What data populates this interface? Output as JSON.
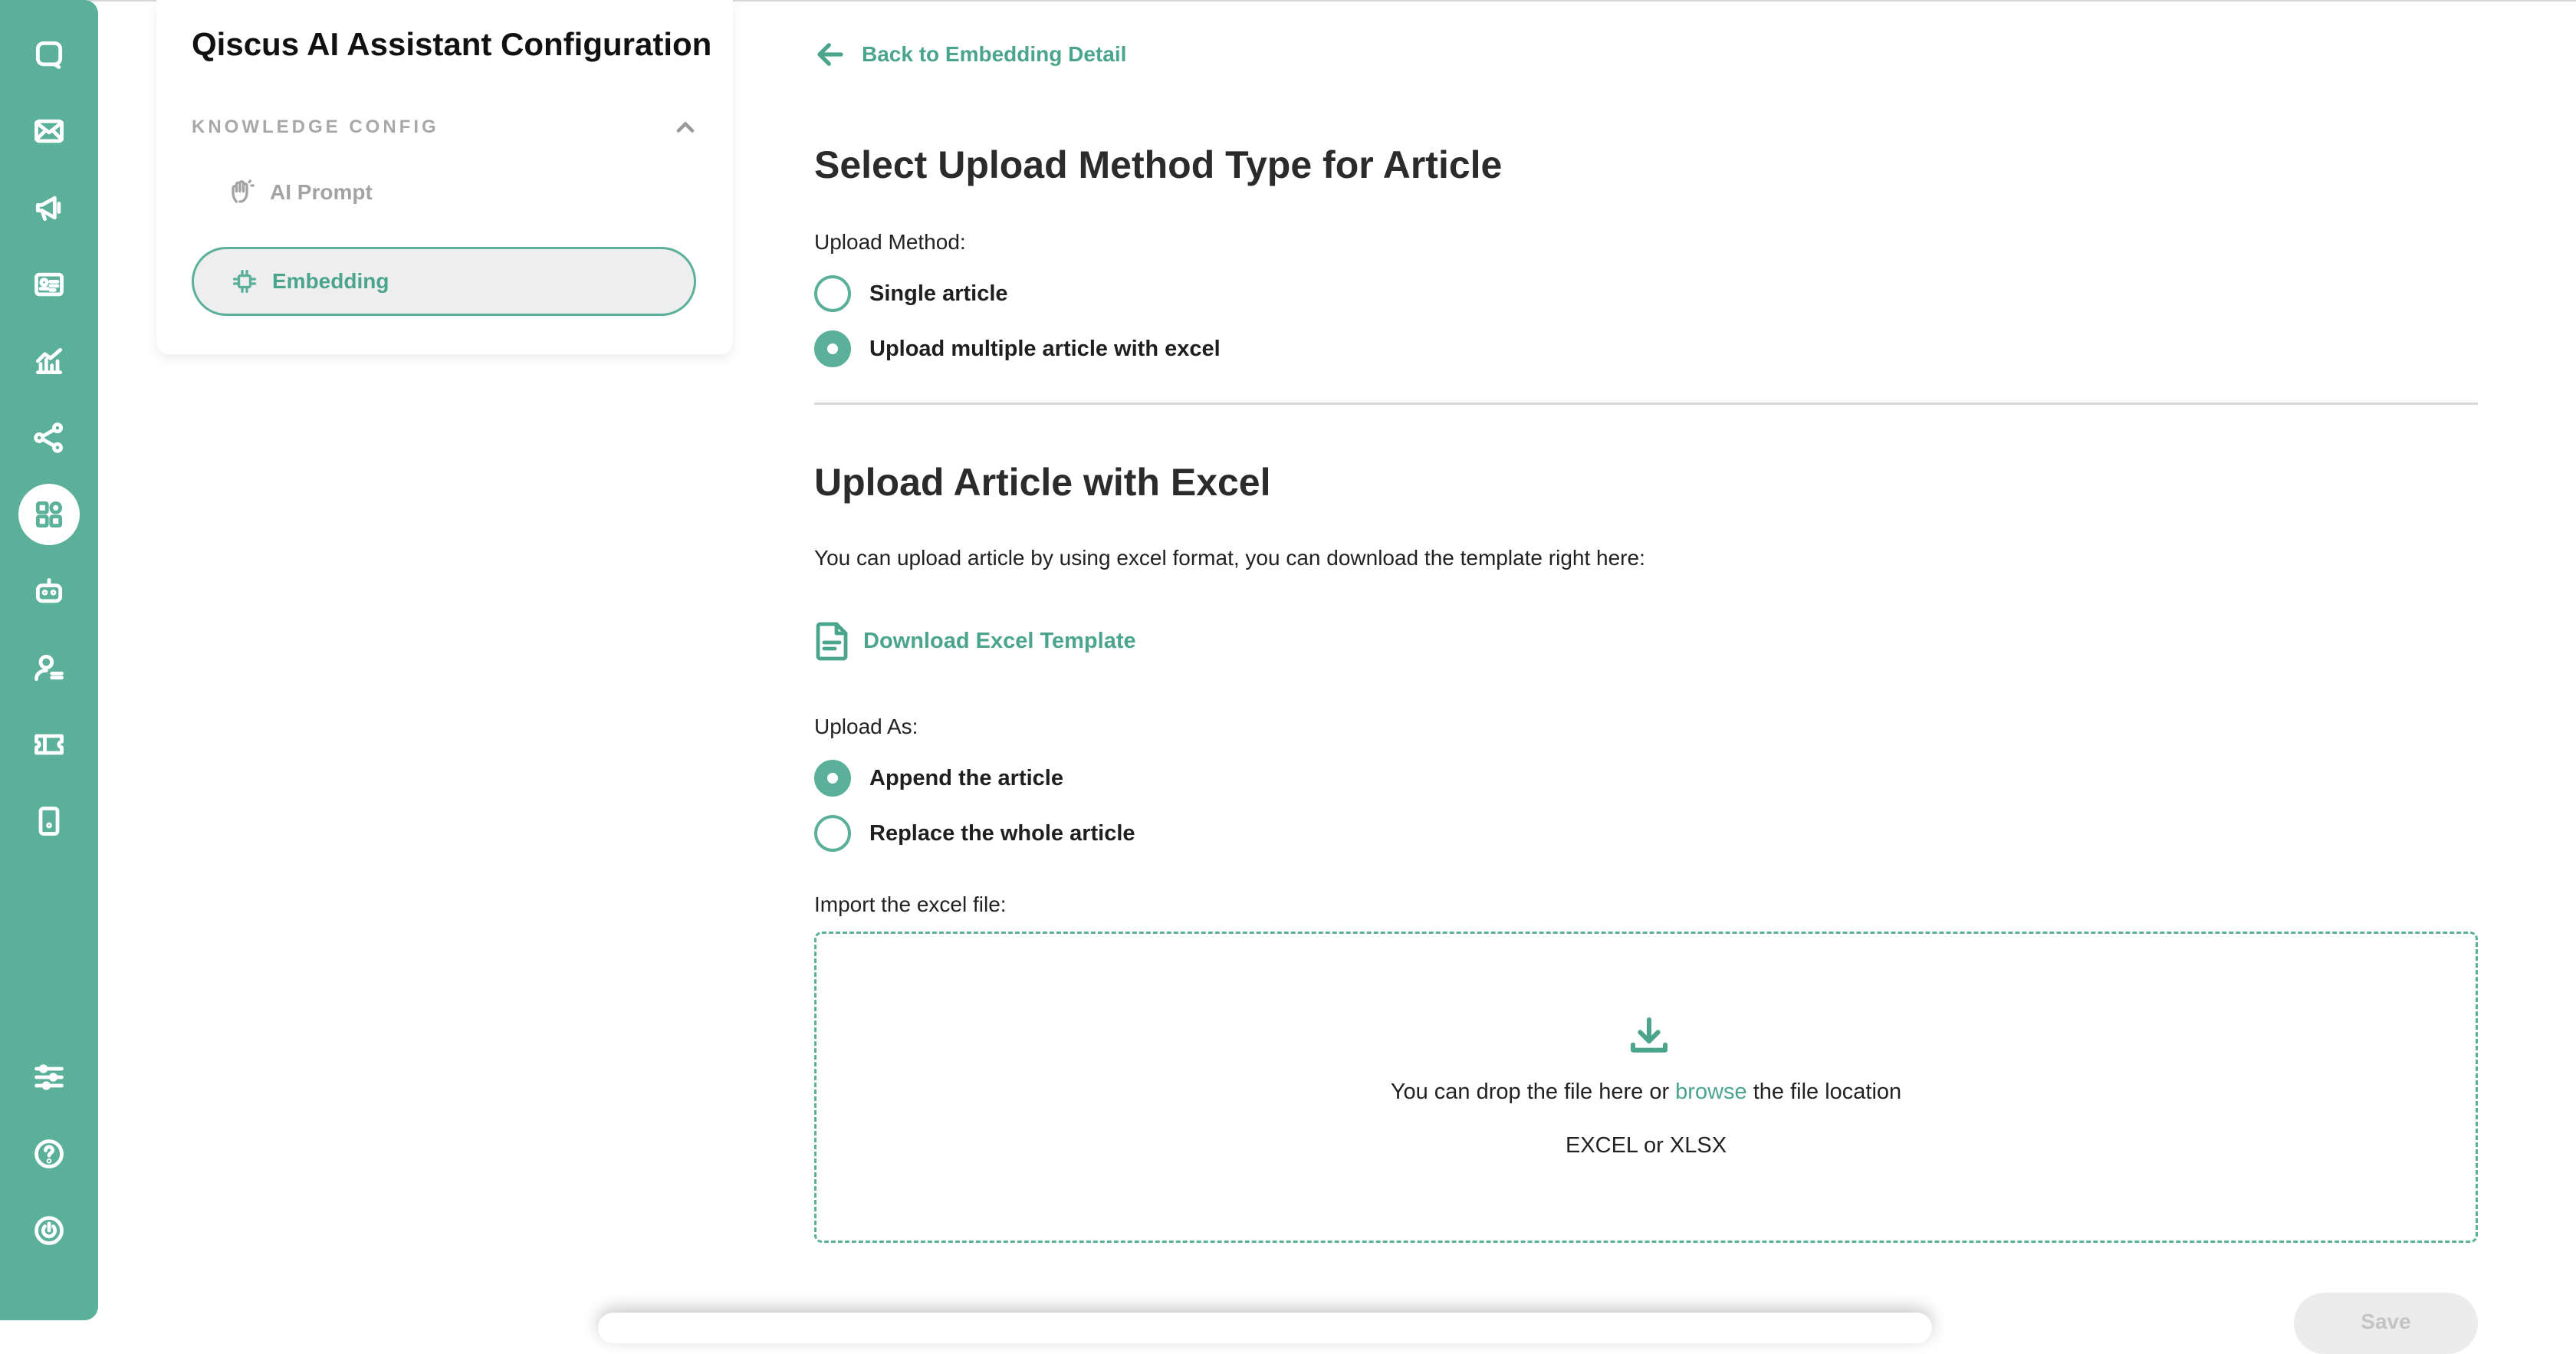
{
  "sidebar": {
    "title": "Qiscus AI Assistant Configuration",
    "section_label": "KNOWLEDGE CONFIG",
    "items": [
      {
        "label": "AI Prompt",
        "icon": "hand-wave-icon",
        "active": false
      },
      {
        "label": "Embedding",
        "icon": "chip-icon",
        "active": true
      }
    ]
  },
  "rail": {
    "icons": [
      "chat-icon",
      "mail-icon",
      "megaphone-icon",
      "contact-card-icon",
      "analytics-icon",
      "integration-icon",
      "apps-grid-icon",
      "bot-icon",
      "agent-icon",
      "ticket-icon",
      "mobile-icon",
      "settings-sliders-icon",
      "help-icon",
      "power-icon"
    ],
    "active": "apps-grid-icon"
  },
  "main": {
    "back_label": "Back to Embedding Detail",
    "method_title": "Select Upload Method Type for Article",
    "method_label": "Upload Method:",
    "method_options": [
      {
        "label": "Single article",
        "checked": false
      },
      {
        "label": "Upload multiple article with excel",
        "checked": true
      }
    ],
    "excel_title": "Upload Article with Excel",
    "excel_description": "You can upload article by using excel format, you can download the template right here:",
    "download_label": "Download Excel Template",
    "upload_as_label": "Upload As:",
    "upload_as_options": [
      {
        "label": "Append the article",
        "checked": true
      },
      {
        "label": "Replace the whole article",
        "checked": false
      }
    ],
    "import_label": "Import the excel file:",
    "dropzone": {
      "text_before": "You can drop the file here or ",
      "browse": "browse",
      "text_after": " the file location",
      "formats": "EXCEL or XLSX"
    },
    "save_label": "Save"
  },
  "colors": {
    "accent": "#5bb09a",
    "accent_text": "#4aa58c"
  }
}
